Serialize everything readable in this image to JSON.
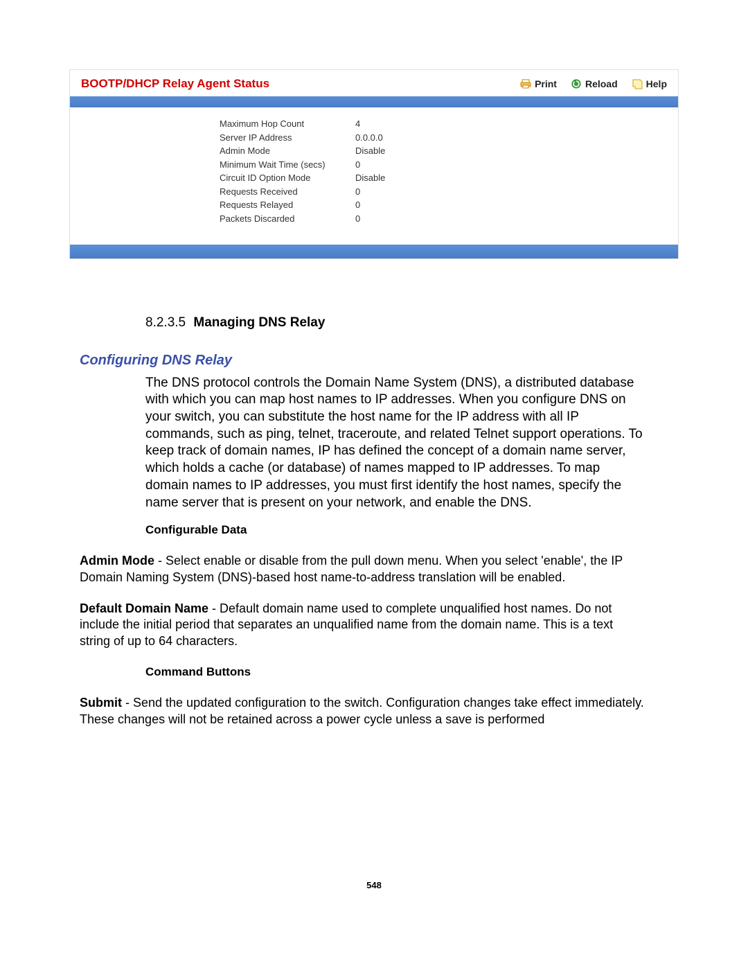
{
  "ui": {
    "title": "BOOTP/DHCP Relay Agent Status",
    "actions": {
      "print": "Print",
      "reload": "Reload",
      "help": "Help"
    },
    "rows": [
      {
        "label": "Maximum Hop Count",
        "value": "4"
      },
      {
        "label": "Server IP Address",
        "value": "0.0.0.0"
      },
      {
        "label": "Admin Mode",
        "value": "Disable"
      },
      {
        "label": "Minimum Wait Time (secs)",
        "value": "0"
      },
      {
        "label": "Circuit ID Option Mode",
        "value": "Disable"
      },
      {
        "label": "Requests Received",
        "value": "0"
      },
      {
        "label": "Requests Relayed",
        "value": "0"
      },
      {
        "label": "Packets Discarded",
        "value": "0"
      }
    ]
  },
  "doc": {
    "sec_num": "8.2.3.5",
    "sec_title": "Managing DNS Relay",
    "subsec_title": "Configuring DNS Relay",
    "intro": "The DNS protocol controls the Domain Name System (DNS), a distributed database with which you can map host names to IP addresses. When you configure DNS on your switch, you can substitute the host name for the IP address with all IP commands, such as ping, telnet, traceroute, and related Telnet support operations. To keep track of domain names, IP has defined the concept of a domain name server, which holds a cache (or database) of names mapped to IP addresses. To map domain names to IP addresses, you must first identify the host names, specify the name server that is present on your network, and enable the DNS.",
    "config_data_heading": "Configurable Data",
    "fields": [
      {
        "name": "Admin Mode",
        "desc": " - Select enable or disable from the pull down menu. When you select 'enable', the IP Domain Naming System (DNS)-based host name-to-address translation will be enabled."
      },
      {
        "name": "Default Domain Name",
        "desc": " - Default domain name used to complete unqualified host names. Do not include the initial period that separates an unqualified name from the domain name. This is a text string of up to 64 characters."
      }
    ],
    "cmd_heading": "Command Buttons",
    "cmd_fields": [
      {
        "name": "Submit",
        "desc": " - Send the updated configuration to the switch. Configuration changes take effect immediately. These changes will not be retained across a power cycle unless a save is performed"
      }
    ],
    "page_number": "548"
  }
}
